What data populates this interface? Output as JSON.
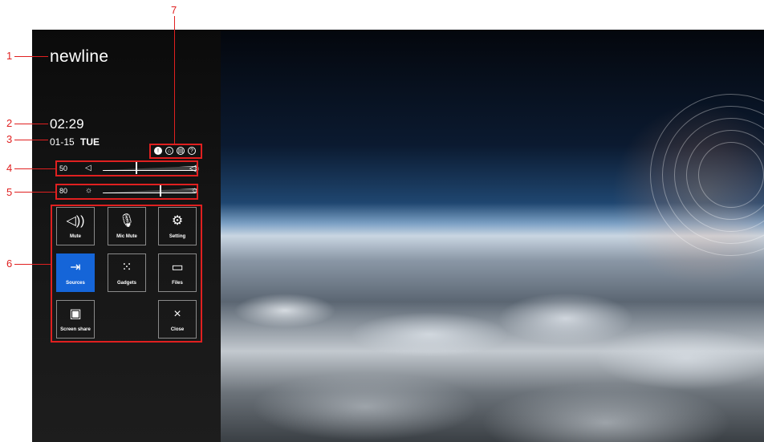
{
  "sidebar": {
    "logo": "newline",
    "time": "02:29",
    "date": "01-15",
    "weekday": "TUE",
    "status_icons": [
      "info-icon",
      "lock-icon",
      "printer-icon",
      "help-icon"
    ],
    "volume": {
      "value": "50",
      "level": 0.35,
      "left_icon": "speaker-low-icon",
      "right_icon": "speaker-high-icon"
    },
    "brightness": {
      "value": "80",
      "level": 0.6,
      "left_icon": "brightness-low-icon",
      "right_icon": "brightness-high-icon"
    },
    "tiles": [
      {
        "label": "Mute",
        "icon": "speaker-icon",
        "active": false
      },
      {
        "label": "Mic Mute",
        "icon": "microphone-icon",
        "active": false
      },
      {
        "label": "Setting",
        "icon": "gear-icon",
        "active": false
      },
      {
        "label": "Sources",
        "icon": "sources-icon",
        "active": true
      },
      {
        "label": "Gadgets",
        "icon": "grid-dots-icon",
        "active": false
      },
      {
        "label": "Files",
        "icon": "folder-icon",
        "active": false
      },
      {
        "label": "Screen share",
        "icon": "screen-share-icon",
        "active": false
      },
      {
        "label": "Close",
        "icon": "close-icon",
        "active": false
      }
    ]
  },
  "callouts": [
    "1",
    "2",
    "3",
    "4",
    "5",
    "6",
    "7"
  ],
  "colors": {
    "accent": "#1565d8",
    "callout": "#e02020"
  }
}
